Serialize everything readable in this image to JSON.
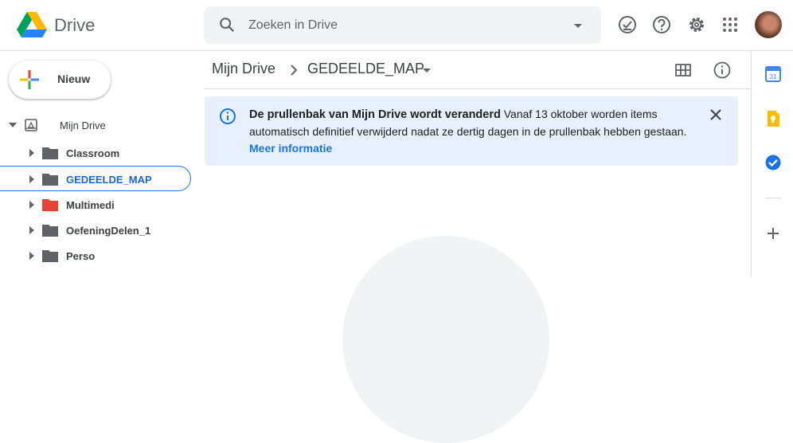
{
  "app": {
    "name": "Drive"
  },
  "search": {
    "placeholder": "Zoeken in Drive"
  },
  "topbar": {
    "icons": [
      "offline-ready-icon",
      "help-icon",
      "settings-icon",
      "apps-grid-icon"
    ]
  },
  "sidebar": {
    "new_label": "Nieuw",
    "root": "Mijn Drive",
    "folders": [
      {
        "name": "Classroom",
        "color": "#5f6368"
      },
      {
        "name": "GEDEELDE_MAP",
        "color": "#5f6368",
        "selected": true
      },
      {
        "name": "Multimedi",
        "color": "#ea4335"
      },
      {
        "name": "OefeningDelen_1",
        "color": "#5f6368"
      },
      {
        "name": "Perso",
        "color": "#5f6368"
      }
    ]
  },
  "breadcrumb": {
    "root": "Mijn Drive",
    "current": "GEDEELDE_MAP"
  },
  "banner": {
    "title": "De prullenbak van Mijn Drive wordt veranderd",
    "body": "Vanaf 13 oktober worden items automatisch definitief verwijderd nadat ze dertig dagen in de prullenbak hebben gestaan.",
    "link": "Meer informatie"
  },
  "side_panel": {
    "icons": [
      "calendar-icon",
      "keep-icon",
      "tasks-icon",
      "add-icon"
    ],
    "calendar_day": "31"
  },
  "colors": {
    "accent": "#1a73e8",
    "banner_bg": "#e8f0fe"
  }
}
